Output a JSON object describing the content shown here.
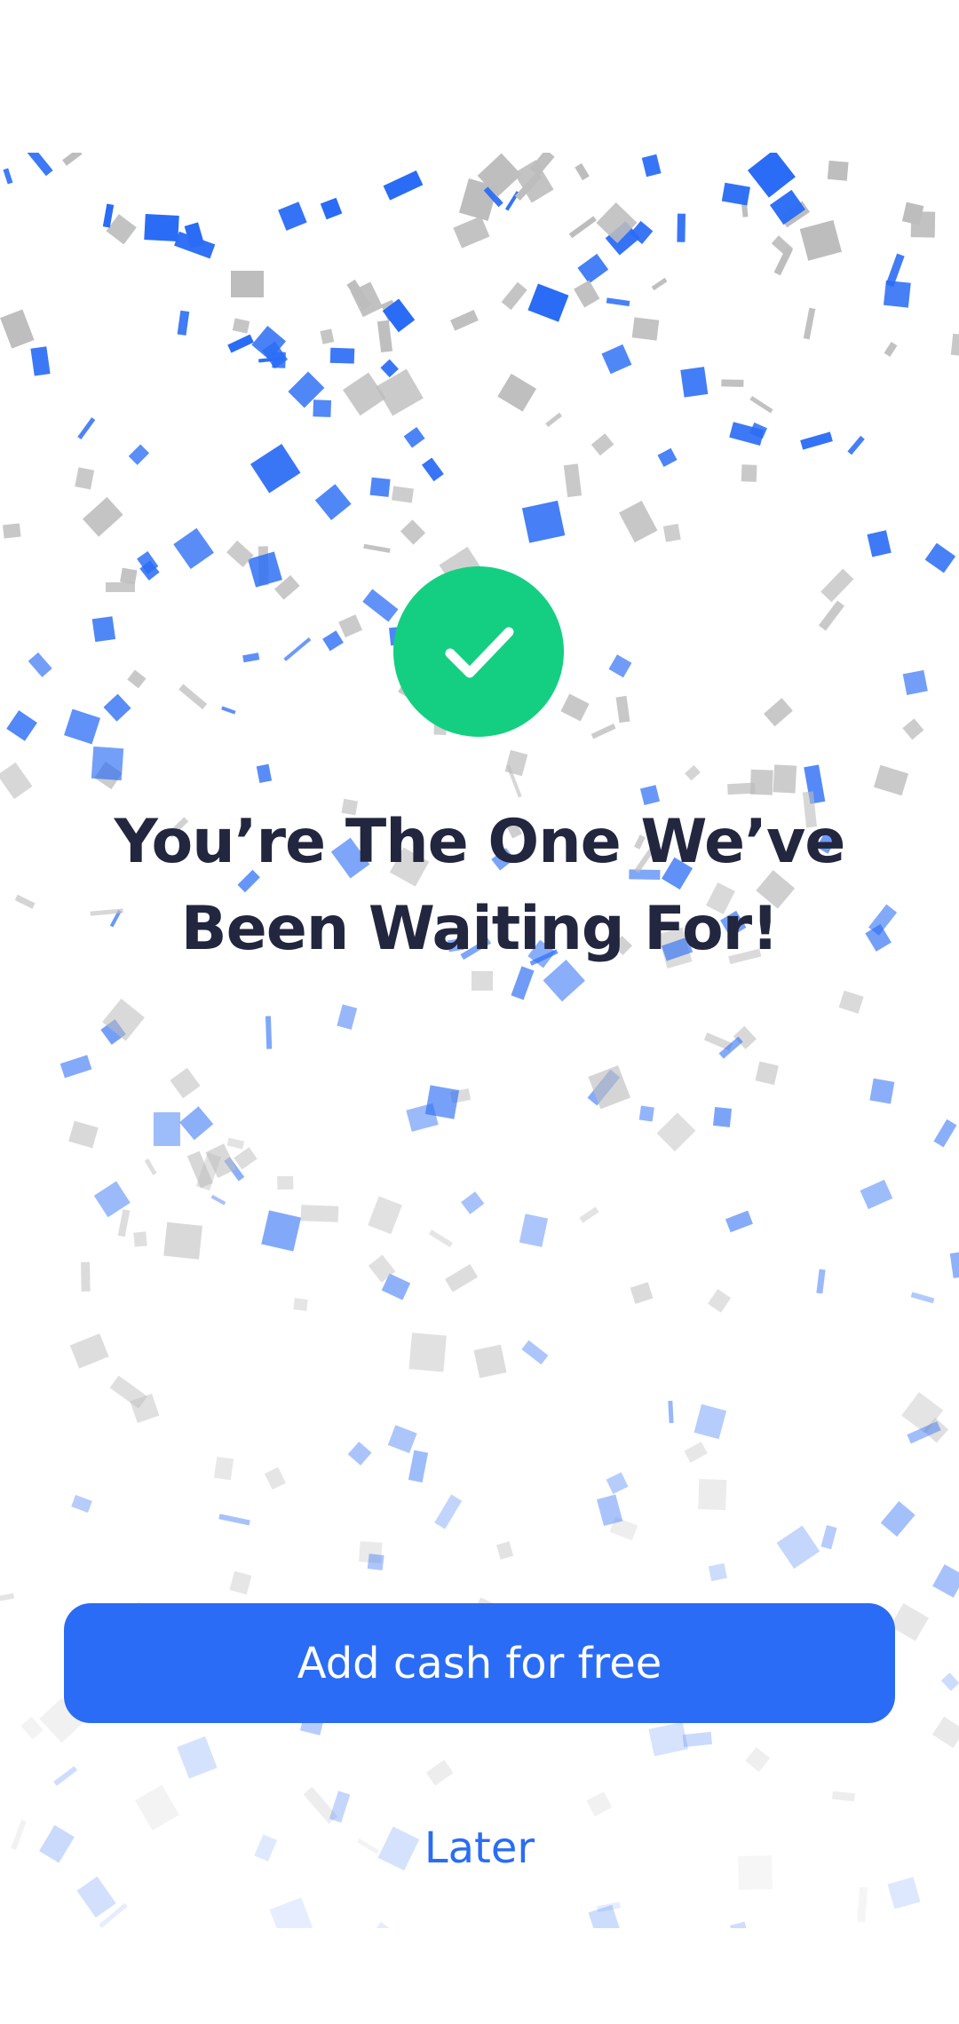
{
  "colors": {
    "background": "#ffffff",
    "accent_blue": "#2a6cf5",
    "success_green": "#14cf82",
    "headline_text": "#23263f",
    "button_text": "#ffffff",
    "confetti_gray": "#bdbdbd"
  },
  "success_icon": {
    "icon": "checkmark-icon"
  },
  "headline": {
    "text": "You’re The One We’ve Been Waiting For!"
  },
  "actions": {
    "primary_label": "Add cash for free",
    "secondary_label": "Later"
  },
  "decoration": {
    "confetti_icon": "confetti",
    "confetti_colors": [
      "#2a6cf5",
      "#bdbdbd"
    ]
  }
}
